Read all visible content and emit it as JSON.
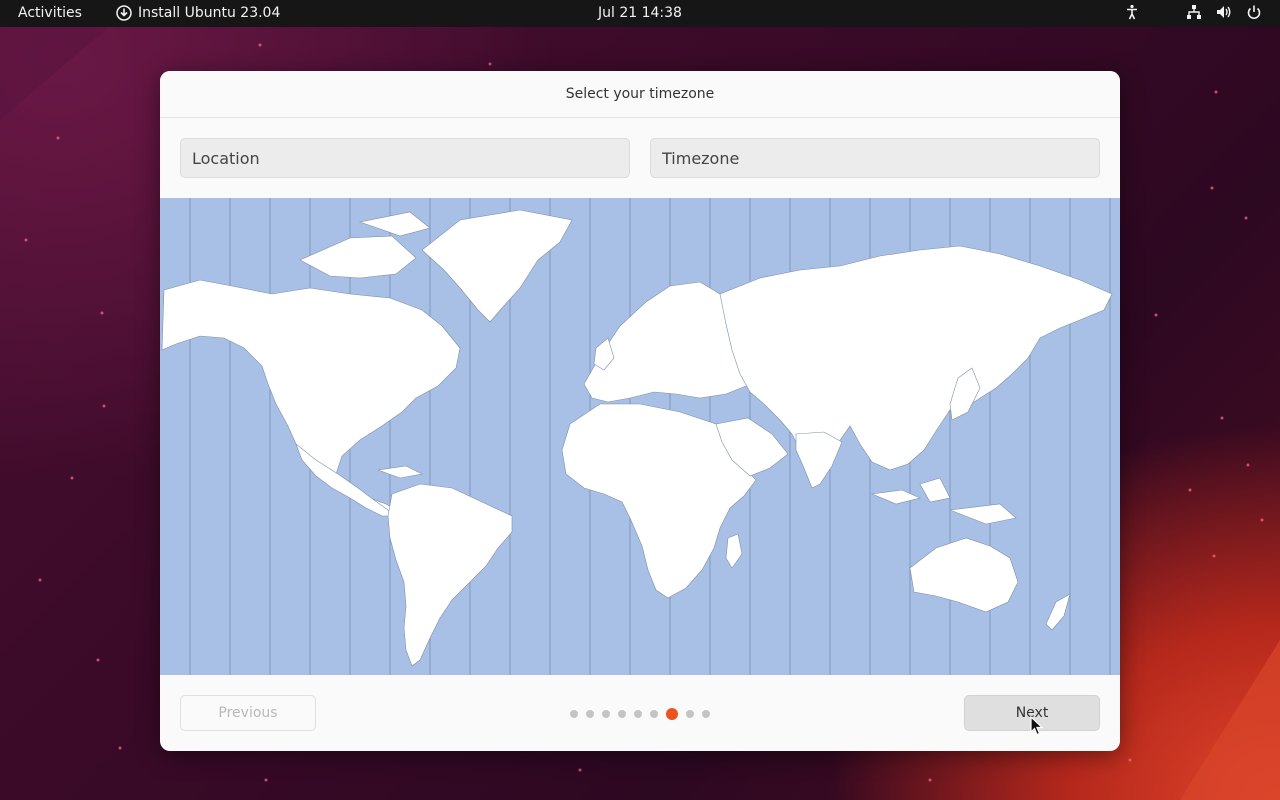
{
  "topbar": {
    "activities": "Activities",
    "app_name": "Install Ubuntu 23.04",
    "clock": "Jul 21  14:38",
    "tray_icons": [
      "accessibility-icon",
      "network-icon",
      "volume-icon",
      "power-icon"
    ]
  },
  "dialog": {
    "title": "Select your timezone",
    "location_placeholder": "Location",
    "timezone_placeholder": "Timezone",
    "previous_label": "Previous",
    "next_label": "Next",
    "steps_total": 9,
    "current_step": 7
  },
  "colors": {
    "accent": "#e95420",
    "map_water": "#a8c0e5",
    "map_land": "#ffffff"
  }
}
